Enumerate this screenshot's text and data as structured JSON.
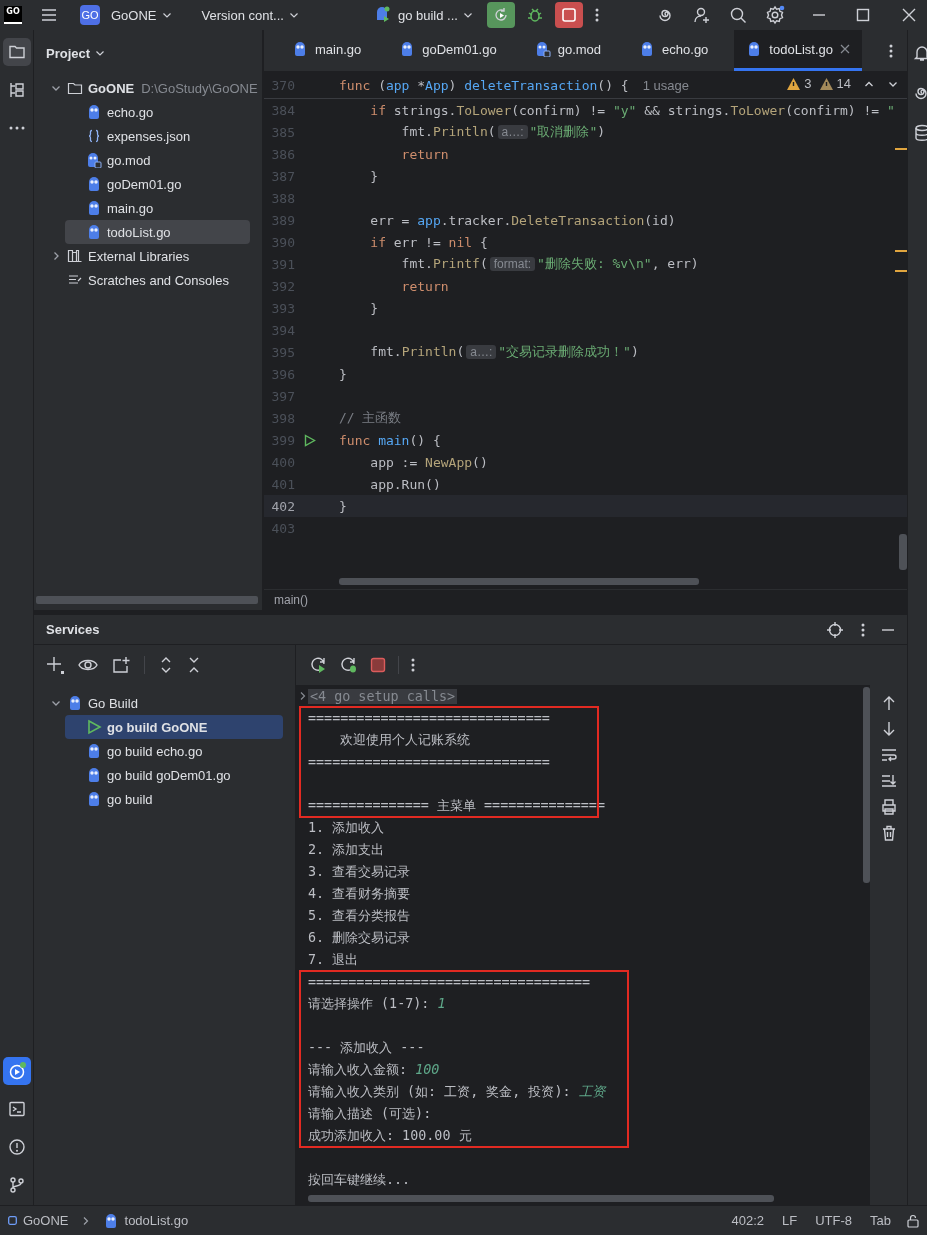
{
  "titlebar": {
    "app_logo": "GO",
    "project_badge": "GO",
    "project": "GoONE",
    "vcs": "Version cont...",
    "run_config": "go build ..."
  },
  "project": {
    "title": "Project",
    "tree": [
      {
        "label": "GoONE",
        "path": "D:\\GoStudy\\GoONE",
        "kind": "folder",
        "expanded": true,
        "selected": false,
        "children": [
          {
            "label": "echo.go",
            "kind": "go",
            "selected": false
          },
          {
            "label": "expenses.json",
            "kind": "json",
            "selected": false
          },
          {
            "label": "go.mod",
            "kind": "mod",
            "selected": false
          },
          {
            "label": "goDem01.go",
            "kind": "go",
            "selected": false
          },
          {
            "label": "main.go",
            "kind": "go",
            "selected": false
          },
          {
            "label": "todoList.go",
            "kind": "go",
            "selected": true
          }
        ]
      },
      {
        "label": "External Libraries",
        "kind": "libraries",
        "expanded": false,
        "selected": false
      },
      {
        "label": "Scratches and Consoles",
        "kind": "scratches",
        "selected": false
      }
    ]
  },
  "tabs": [
    {
      "label": "main.go",
      "kind": "go",
      "selected": false
    },
    {
      "label": "goDem01.go",
      "kind": "go",
      "selected": false
    },
    {
      "label": "go.mod",
      "kind": "mod",
      "selected": false
    },
    {
      "label": "echo.go",
      "kind": "go",
      "selected": false
    },
    {
      "label": "todoList.go",
      "kind": "go",
      "selected": true
    }
  ],
  "editor": {
    "sticky_line": {
      "number": "370",
      "hint": "1 usage",
      "tokens": [
        {
          "kind": "keyword",
          "text": "func"
        },
        {
          "kind": "plain",
          "text": " ("
        },
        {
          "kind": "receiver",
          "text": "app"
        },
        {
          "kind": "plain",
          "text": " *"
        },
        {
          "kind": "receiver",
          "text": "App"
        },
        {
          "kind": "plain",
          "text": ") "
        },
        {
          "kind": "declaration",
          "text": "deleteTransaction"
        },
        {
          "kind": "plain",
          "text": "() {"
        }
      ]
    },
    "warnings": "3",
    "weak_warnings": "14",
    "lines": [
      {
        "number": "384",
        "current": false,
        "runnable": false,
        "tokens": [
          {
            "kind": "keyword",
            "text": "    if"
          },
          {
            "kind": "plain",
            "text": " strings."
          },
          {
            "kind": "call",
            "text": "ToLower"
          },
          {
            "kind": "plain",
            "text": "(confirm) != "
          },
          {
            "kind": "string",
            "text": "\"y\""
          },
          {
            "kind": "plain",
            "text": " && strings."
          },
          {
            "kind": "call",
            "text": "ToLower"
          },
          {
            "kind": "plain",
            "text": "(confirm) != "
          },
          {
            "kind": "string",
            "text": "\""
          }
        ]
      },
      {
        "number": "385",
        "current": false,
        "runnable": false,
        "tokens": [
          {
            "kind": "plain",
            "text": "        fmt."
          },
          {
            "kind": "call",
            "text": "Println"
          },
          {
            "kind": "plain",
            "text": "("
          },
          {
            "kind": "hint",
            "text": "a…:"
          },
          {
            "kind": "string",
            "text": "\"取消删除\""
          },
          {
            "kind": "plain",
            "text": ")"
          }
        ]
      },
      {
        "number": "386",
        "current": false,
        "runnable": false,
        "tokens": [
          {
            "kind": "keyword",
            "text": "        return"
          }
        ]
      },
      {
        "number": "387",
        "current": false,
        "runnable": false,
        "tokens": [
          {
            "kind": "plain",
            "text": "    }"
          }
        ]
      },
      {
        "number": "388",
        "current": false,
        "runnable": false
      },
      {
        "number": "389",
        "current": false,
        "runnable": false,
        "tokens": [
          {
            "kind": "plain",
            "text": "    err = "
          },
          {
            "kind": "receiver",
            "text": "app"
          },
          {
            "kind": "plain",
            "text": ".tracker."
          },
          {
            "kind": "call",
            "text": "DeleteTransaction"
          },
          {
            "kind": "plain",
            "text": "(id)"
          }
        ]
      },
      {
        "number": "390",
        "current": false,
        "runnable": false,
        "tokens": [
          {
            "kind": "keyword",
            "text": "    if"
          },
          {
            "kind": "plain",
            "text": " err != "
          },
          {
            "kind": "keyword",
            "text": "nil"
          },
          {
            "kind": "plain",
            "text": " {"
          }
        ]
      },
      {
        "number": "391",
        "current": false,
        "runnable": false,
        "tokens": [
          {
            "kind": "plain",
            "text": "        fmt."
          },
          {
            "kind": "call",
            "text": "Printf"
          },
          {
            "kind": "plain",
            "text": "("
          },
          {
            "kind": "hint",
            "text": "format:"
          },
          {
            "kind": "string",
            "text": "\"删除失败: %v\\n\""
          },
          {
            "kind": "plain",
            "text": ", err)"
          }
        ]
      },
      {
        "number": "392",
        "current": false,
        "runnable": false,
        "tokens": [
          {
            "kind": "keyword",
            "text": "        return"
          }
        ]
      },
      {
        "number": "393",
        "current": false,
        "runnable": false,
        "tokens": [
          {
            "kind": "plain",
            "text": "    }"
          }
        ]
      },
      {
        "number": "394",
        "current": false,
        "runnable": false
      },
      {
        "number": "395",
        "current": false,
        "runnable": false,
        "tokens": [
          {
            "kind": "plain",
            "text": "    fmt."
          },
          {
            "kind": "call",
            "text": "Println"
          },
          {
            "kind": "plain",
            "text": "("
          },
          {
            "kind": "hint",
            "text": "a…:"
          },
          {
            "kind": "string",
            "text": "\"交易记录删除成功！\""
          },
          {
            "kind": "plain",
            "text": ")"
          }
        ]
      },
      {
        "number": "396",
        "current": false,
        "runnable": false,
        "tokens": [
          {
            "kind": "plain",
            "text": "}"
          }
        ]
      },
      {
        "number": "397",
        "current": false,
        "runnable": false
      },
      {
        "number": "398",
        "current": false,
        "runnable": false,
        "tokens": [
          {
            "kind": "comment",
            "text": "// 主函数"
          }
        ]
      },
      {
        "number": "399",
        "current": false,
        "runnable": true,
        "tokens": [
          {
            "kind": "keyword",
            "text": "func "
          },
          {
            "kind": "declaration",
            "text": "main"
          },
          {
            "kind": "plain",
            "text": "() {"
          }
        ]
      },
      {
        "number": "400",
        "current": false,
        "runnable": false,
        "tokens": [
          {
            "kind": "plain",
            "text": "    app := "
          },
          {
            "kind": "call",
            "text": "NewApp"
          },
          {
            "kind": "plain",
            "text": "()"
          }
        ]
      },
      {
        "number": "401",
        "current": false,
        "runnable": false,
        "tokens": [
          {
            "kind": "plain",
            "text": "    app.Run()"
          }
        ]
      },
      {
        "number": "402",
        "current": true,
        "runnable": false,
        "tokens": [
          {
            "kind": "plain",
            "text": "}"
          }
        ]
      },
      {
        "number": "403",
        "current": false,
        "runnable": false
      }
    ],
    "breadcrumb": "main()"
  },
  "services": {
    "title": "Services",
    "tree": [
      {
        "label": "Go Build",
        "kind": "group",
        "expanded": true,
        "selected": false,
        "children": [
          {
            "label": "go build GoONE",
            "kind": "running",
            "selected": true
          },
          {
            "label": "go build echo.go",
            "kind": "config",
            "selected": false
          },
          {
            "label": "go build goDem01.go",
            "kind": "config",
            "selected": false
          },
          {
            "label": "go build",
            "kind": "config",
            "selected": false
          }
        ]
      }
    ],
    "console": [
      {
        "kind": "folded",
        "text": "<4 go setup calls>",
        "framed": false
      },
      {
        "kind": "output",
        "text": "==============================",
        "framed": true
      },
      {
        "kind": "output",
        "text": "    欢迎使用个人记账系统",
        "framed": true
      },
      {
        "kind": "output",
        "text": "==============================",
        "framed": true
      },
      {
        "kind": "blank",
        "framed": true
      },
      {
        "kind": "output",
        "text": "=============== 主菜单 ===============",
        "framed": true
      },
      {
        "kind": "output",
        "text": "1. 添加收入",
        "framed": false
      },
      {
        "kind": "output",
        "text": "2. 添加支出",
        "framed": false
      },
      {
        "kind": "output",
        "text": "3. 查看交易记录",
        "framed": false
      },
      {
        "kind": "output",
        "text": "4. 查看财务摘要",
        "framed": false
      },
      {
        "kind": "output",
        "text": "5. 查看分类报告",
        "framed": false
      },
      {
        "kind": "output",
        "text": "6. 删除交易记录",
        "framed": false
      },
      {
        "kind": "output",
        "text": "7. 退出",
        "framed": false
      },
      {
        "kind": "output",
        "text": "===================================",
        "framed": true
      },
      {
        "kind": "output",
        "text": "请选择操作 (1-7): ",
        "input": "1",
        "framed": true
      },
      {
        "kind": "blank",
        "framed": true
      },
      {
        "kind": "output",
        "text": "--- 添加收入 ---",
        "framed": true
      },
      {
        "kind": "output",
        "text": "请输入收入金额: ",
        "input": "100",
        "framed": true
      },
      {
        "kind": "output",
        "text": "请输入收入类别 (如: 工资, 奖金, 投资): ",
        "input": "工资",
        "framed": true
      },
      {
        "kind": "output",
        "text": "请输入描述 (可选):",
        "framed": true
      },
      {
        "kind": "output",
        "text": "成功添加收入: 100.00 元",
        "framed": true
      },
      {
        "kind": "blank",
        "framed": false
      },
      {
        "kind": "output",
        "text": "按回车键继续...",
        "framed": false
      }
    ]
  },
  "status_bar": {
    "project": "GoONE",
    "file": "todoList.go",
    "position": "402:2",
    "line_separator": "LF",
    "encoding": "UTF-8",
    "indent": "Tab"
  }
}
